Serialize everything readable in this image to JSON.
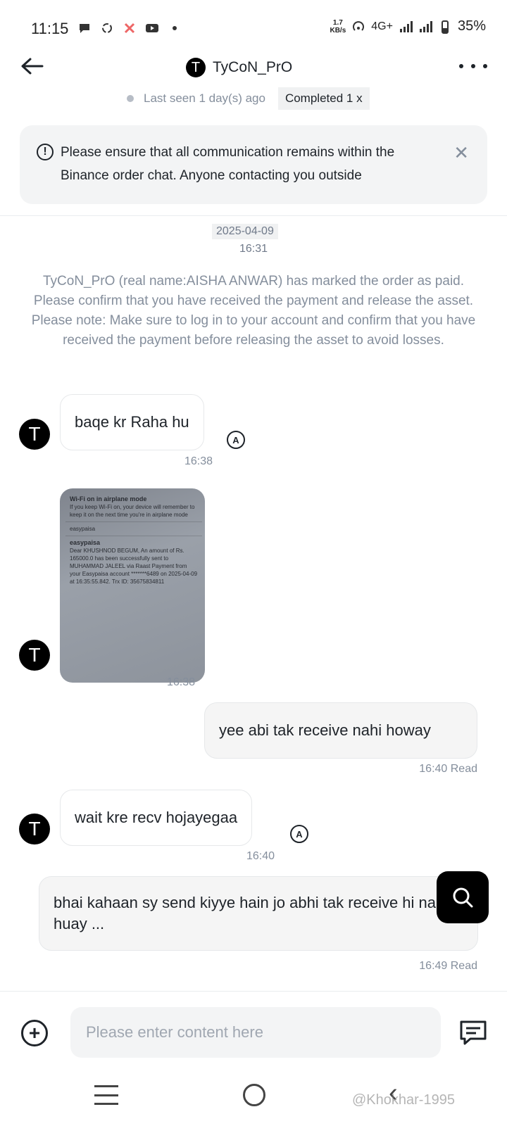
{
  "status_bar": {
    "time": "11:15",
    "speed_value": "1.7",
    "speed_unit": "KB/s",
    "network": "4G+",
    "battery": "35%"
  },
  "header": {
    "avatar_letter": "T",
    "title": "TyCoN_PrO",
    "last_seen": "Last seen 1 day(s) ago",
    "status_badge": "Completed 1 x"
  },
  "notice": {
    "text": "Please ensure that all communication remains within the Binance order chat. Anyone contacting you outside"
  },
  "chat": {
    "date": "2025-04-09",
    "date_time": "16:31",
    "system_message": "TyCoN_PrO (real name:AISHA ANWAR) has marked the order as paid. Please confirm that you have received the payment and release the asset. Please note: Make sure to log in to your account and confirm that you have received the payment before releasing the asset to avoid losses.",
    "messages": [
      {
        "text": "baqe kr Raha hu",
        "time": "16:38"
      },
      {
        "time": "16:38"
      },
      {
        "text": "yee abi tak receive nahi howay",
        "time": "16:40 Read"
      },
      {
        "text": "wait kre recv hojayegaa",
        "time": "16:40"
      },
      {
        "text": "bhai kahaan sy send kiyye hain jo abhi tak receive hi nahi huay ...",
        "time": "16:49 Read"
      }
    ],
    "screenshot": {
      "title": "Wi-Fi on in airplane mode",
      "body": "If you keep Wi-Fi on, your device will remember to keep it on the next time you're in airplane mode",
      "app": "easypaisa",
      "sms": "Dear KHUSHNOD BEGUM, An amount of Rs. 165000.0 has been successfully sent to MUHAMMAD JALEEL via Raast Payment from your Easypaisa account *******6489 on 2025-04-09 at 16:35:55.842. Trx ID: 35675834811"
    }
  },
  "input": {
    "placeholder": "Please enter content here"
  },
  "watermark": "@Khokhar-1995",
  "icons": {
    "back": "arrow-left-icon",
    "more": "more-dots-icon",
    "translate": "translate-icon",
    "search": "search-icon",
    "add": "plus-circle-icon",
    "quick": "chat-lines-icon"
  }
}
